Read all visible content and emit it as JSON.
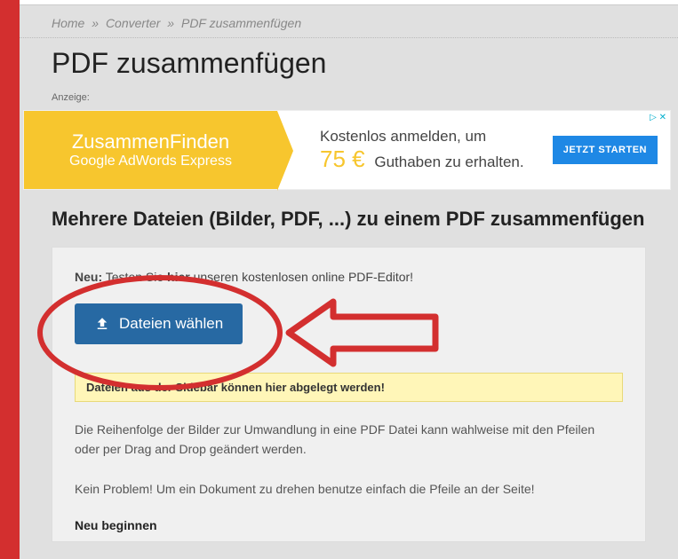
{
  "breadcrumb": {
    "home": "Home",
    "converter": "Converter",
    "current": "PDF zusammenfügen"
  },
  "title": "PDF zusammenfügen",
  "anzeige_label": "Anzeige:",
  "ad": {
    "brand_line1": "ZusammenFinden",
    "brand_line2": "Google AdWords Express",
    "text_line1": "Kostenlos anmelden, um",
    "price": "75 €",
    "text_line2": "Guthaben zu erhalten.",
    "cta": "JETZT STARTEN",
    "adchoices": "▷ ✕"
  },
  "subtitle": "Mehrere Dateien (Bilder, PDF, ...) zu einem PDF zusammenfügen",
  "content": {
    "neu_label": "Neu:",
    "neu_text_before": " Testen Sie ",
    "neu_hier": "hier",
    "neu_text_after": " unseren kostenlosen online PDF-Editor!",
    "file_button": "Dateien wählen",
    "drop_zone": "Dateien aus der Sidebar können hier abgelegt werden!",
    "desc1": "Die Reihenfolge der Bilder zur Umwandlung in eine PDF Datei kann wahlweise mit den Pfeilen oder per Drag and Drop geändert werden.",
    "desc2": "Kein Problem! Um ein Dokument zu drehen benutze einfach die Pfeile an der Seite!",
    "neu_beginnen": "Neu beginnen"
  }
}
